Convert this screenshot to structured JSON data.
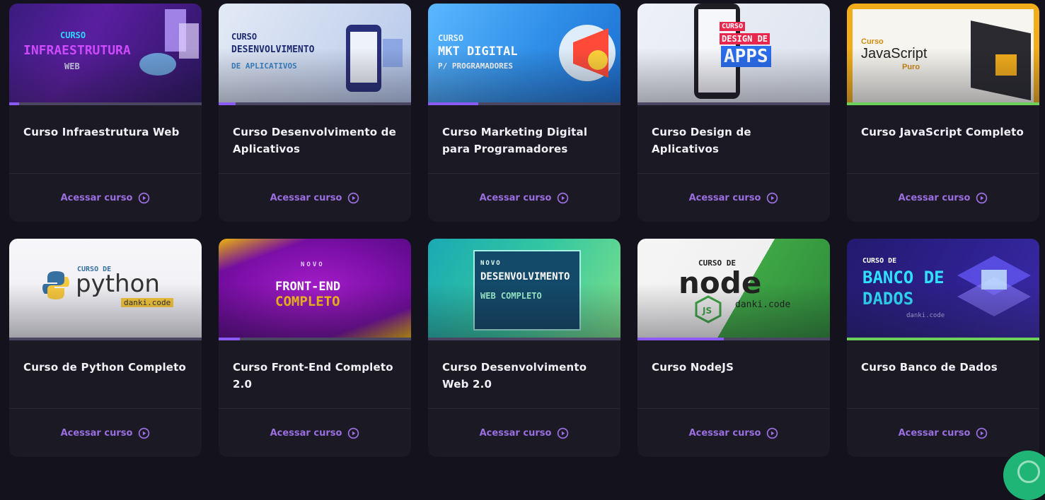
{
  "courses": [
    {
      "title": "Curso Infraestrutura Web",
      "action": "Acessar curso",
      "thumb": {
        "line1": "CURSO",
        "line2": "INFRAESTRUTURA",
        "line3": "WEB"
      },
      "progress": 0.05,
      "progress_color": "#8a5cf5"
    },
    {
      "title": "Curso Desenvolvimento de Aplicativos",
      "action": "Acessar curso",
      "thumb": {
        "line1": "CURSO",
        "line2": "DESENVOLVIMENTO",
        "line3": "DE APLICATIVOS"
      },
      "progress": 0.09,
      "progress_color": "#8a5cf5"
    },
    {
      "title": "Curso Marketing Digital para Programadores",
      "action": "Acessar curso",
      "thumb": {
        "line1": "CURSO",
        "line2": "MKT DIGITAL",
        "line3": "P/ PROGRAMADORES"
      },
      "progress": 0.26,
      "progress_color": "#8a5cf5"
    },
    {
      "title": "Curso Design de Aplicativos",
      "action": "Acessar curso",
      "thumb": {
        "line1": "CURSO",
        "line2": "DESIGN DE",
        "line3": "APPS"
      },
      "progress": 0,
      "progress_color": "#8a5cf5"
    },
    {
      "title": "Curso JavaScript Completo",
      "action": "Acessar curso",
      "thumb": {
        "line1": "Curso",
        "line2": "JavaScript",
        "line3": "Puro"
      },
      "progress": 1,
      "progress_color": "#6cd05a"
    },
    {
      "title": "Curso de Python Completo",
      "action": "Acessar curso",
      "thumb": {
        "line1": "CURSO DE",
        "line2": "python",
        "line3": "danki.code"
      },
      "progress": 0,
      "progress_color": "#8a5cf5"
    },
    {
      "title": "Curso Front-End Completo 2.0",
      "action": "Acessar curso",
      "thumb": {
        "line1": "NOVO",
        "line2": "FRONT-END",
        "line3": "COMPLETO"
      },
      "progress": 0.11,
      "progress_color": "#8a5cf5"
    },
    {
      "title": "Curso Desenvolvimento Web 2.0",
      "action": "Acessar curso",
      "thumb": {
        "line1": "NOVO",
        "line2": "DESENVOLVIMENTO",
        "line3": "WEB COMPLETO"
      },
      "progress": 0,
      "progress_color": "#8a5cf5"
    },
    {
      "title": "Curso NodeJS",
      "action": "Acessar curso",
      "thumb": {
        "line1": "CURSO DE",
        "line2": "node",
        "line3": "danki.code"
      },
      "progress": 0.45,
      "progress_color": "#8a5cf5"
    },
    {
      "title": "Curso Banco de Dados",
      "action": "Acessar curso",
      "thumb": {
        "line1": "CURSO DE",
        "line2": "BANCO DE DADOS",
        "line3": "danki.code"
      },
      "progress": 1,
      "progress_color": "#6cd05a"
    }
  ],
  "colors": {
    "accent": "#9a6ee0",
    "card_bg": "#1b1924",
    "page_bg": "#14121c",
    "chat": "#1fb576"
  },
  "icons": {
    "action": "play-circle-icon",
    "chat": "chat-icon"
  }
}
